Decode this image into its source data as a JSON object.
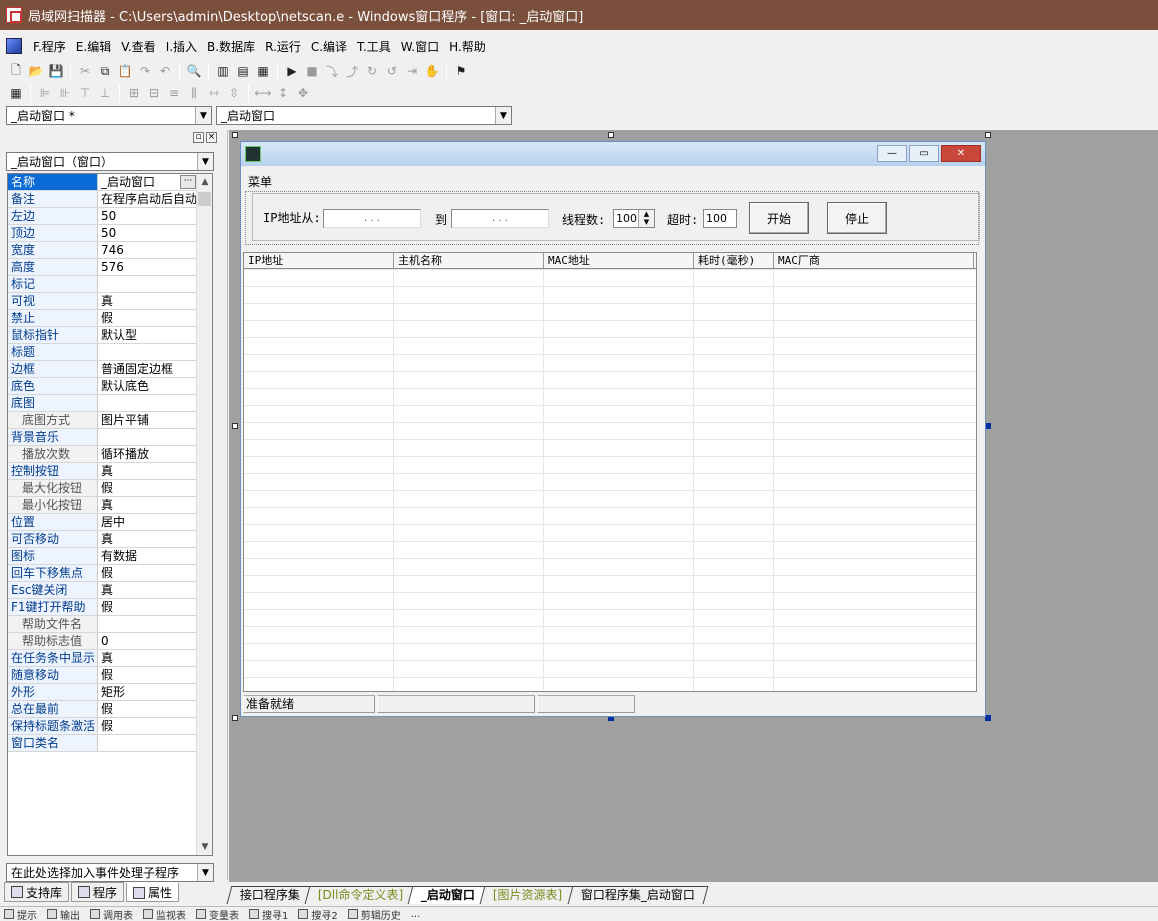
{
  "window": {
    "title": "局域网扫描器 - C:\\Users\\admin\\Desktop\\netscan.e - Windows窗口程序 - [窗口: _启动窗口]"
  },
  "menu": [
    {
      "label": "F.程序"
    },
    {
      "label": "E.编辑"
    },
    {
      "label": "V.查看"
    },
    {
      "label": "I.插入"
    },
    {
      "label": "B.数据库"
    },
    {
      "label": "R.运行"
    },
    {
      "label": "C.编译"
    },
    {
      "label": "T.工具"
    },
    {
      "label": "W.窗口"
    },
    {
      "label": "H.帮助"
    }
  ],
  "toolbar": {
    "icons": [
      "new-file-icon",
      "open-folder-icon",
      "save-icon",
      "cut-icon",
      "copy-icon",
      "paste-icon",
      "redo-icon",
      "undo-icon",
      "find-icon",
      "layout1-icon",
      "layout2-icon",
      "layout3-icon",
      "run-icon",
      "stop-icon",
      "step1-icon",
      "step2-icon",
      "step3-icon",
      "step4-icon",
      "step5-icon",
      "hand-icon",
      "debug-icon"
    ]
  },
  "selectors": {
    "left": "_启动窗口 *",
    "right": "_启动窗口"
  },
  "properties": {
    "object_combo": "_启动窗口（窗口）",
    "rows": [
      {
        "name": "名称",
        "value": "_启动窗口"
      },
      {
        "name": "备注",
        "value": "在程序启动后自动"
      },
      {
        "name": "左边",
        "value": "50"
      },
      {
        "name": "顶边",
        "value": "50"
      },
      {
        "name": "宽度",
        "value": "746"
      },
      {
        "name": "高度",
        "value": "576"
      },
      {
        "name": "标记",
        "value": ""
      },
      {
        "name": "可视",
        "value": "真"
      },
      {
        "name": "禁止",
        "value": "假"
      },
      {
        "name": "鼠标指针",
        "value": "默认型"
      },
      {
        "name": "标题",
        "value": ""
      },
      {
        "name": "边框",
        "value": "普通固定边框"
      },
      {
        "name": "底色",
        "value": "默认底色"
      },
      {
        "name": "底图",
        "value": ""
      },
      {
        "name": "底图方式",
        "value": "图片平铺"
      },
      {
        "name": "背景音乐",
        "value": ""
      },
      {
        "name": "播放次数",
        "value": "循环播放"
      },
      {
        "name": "控制按钮",
        "value": "真"
      },
      {
        "name": "最大化按钮",
        "value": "假"
      },
      {
        "name": "最小化按钮",
        "value": "真"
      },
      {
        "name": "位置",
        "value": "居中"
      },
      {
        "name": "可否移动",
        "value": "真"
      },
      {
        "name": "图标",
        "value": "有数据"
      },
      {
        "name": "回车下移焦点",
        "value": "假"
      },
      {
        "name": "Esc键关闭",
        "value": "真"
      },
      {
        "name": "F1键打开帮助",
        "value": "假"
      },
      {
        "name": "帮助文件名",
        "value": ""
      },
      {
        "name": "帮助标志值",
        "value": "0"
      },
      {
        "name": "在任务条中显示",
        "value": "真"
      },
      {
        "name": "随意移动",
        "value": "假"
      },
      {
        "name": "外形",
        "value": "矩形"
      },
      {
        "name": "总在最前",
        "value": "假"
      },
      {
        "name": "保持标题条激活",
        "value": "假"
      },
      {
        "name": "窗口类名",
        "value": ""
      }
    ],
    "event_combo": "在此处选择加入事件处理子程序",
    "tabs": [
      {
        "label": "支持库"
      },
      {
        "label": "程序"
      },
      {
        "label": "属性"
      }
    ]
  },
  "form": {
    "menu_label": "菜单",
    "ip_from_label": "IP地址从:",
    "ip_placeholder": ".   .   .",
    "to_label": "到",
    "threads_label": "线程数:",
    "threads_value": "100",
    "timeout_label": "超时:",
    "timeout_value": "100",
    "start_button": "开始",
    "stop_button": "停止",
    "columns": [
      "IP地址",
      "主机名称",
      "MAC地址",
      "耗时(毫秒)",
      "MAC厂商"
    ],
    "status": [
      "准备就绪",
      "",
      ""
    ]
  },
  "doc_tabs": [
    {
      "label": "接口程序集"
    },
    {
      "label": "[Dll命令定义表]"
    },
    {
      "label": "_启动窗口"
    },
    {
      "label": "[图片资源表]"
    },
    {
      "label": "窗口程序集_启动窗口"
    }
  ],
  "bottom_strip": [
    {
      "label": "提示"
    },
    {
      "label": "输出"
    },
    {
      "label": "调用表"
    },
    {
      "label": "监视表"
    },
    {
      "label": "变量表"
    },
    {
      "label": "搜寻1"
    },
    {
      "label": "搜寻2"
    },
    {
      "label": "剪辑历史"
    },
    {
      "label": "..."
    }
  ]
}
